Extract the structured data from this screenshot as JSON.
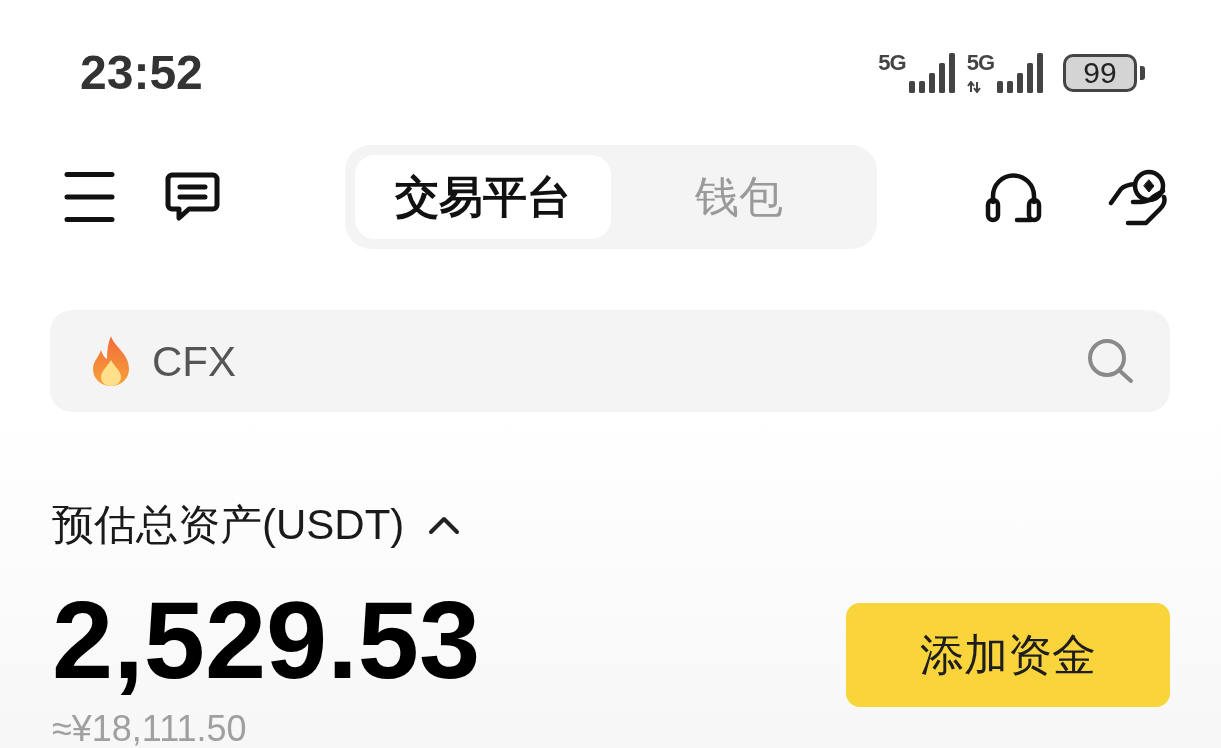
{
  "status_bar": {
    "time": "23:52",
    "signals": [
      {
        "label": "5G",
        "data_active": false
      },
      {
        "label": "5G",
        "data_active": true
      }
    ],
    "battery": "99"
  },
  "tabs": [
    {
      "label": "交易平台",
      "selected": true
    },
    {
      "label": "钱包",
      "selected": false
    }
  ],
  "search": {
    "placeholder": "CFX"
  },
  "assets": {
    "label": "预估总资产(USDT)",
    "expanded": true,
    "amount": "2,529.53",
    "converted": "≈¥18,111.50",
    "button": "添加资金"
  }
}
